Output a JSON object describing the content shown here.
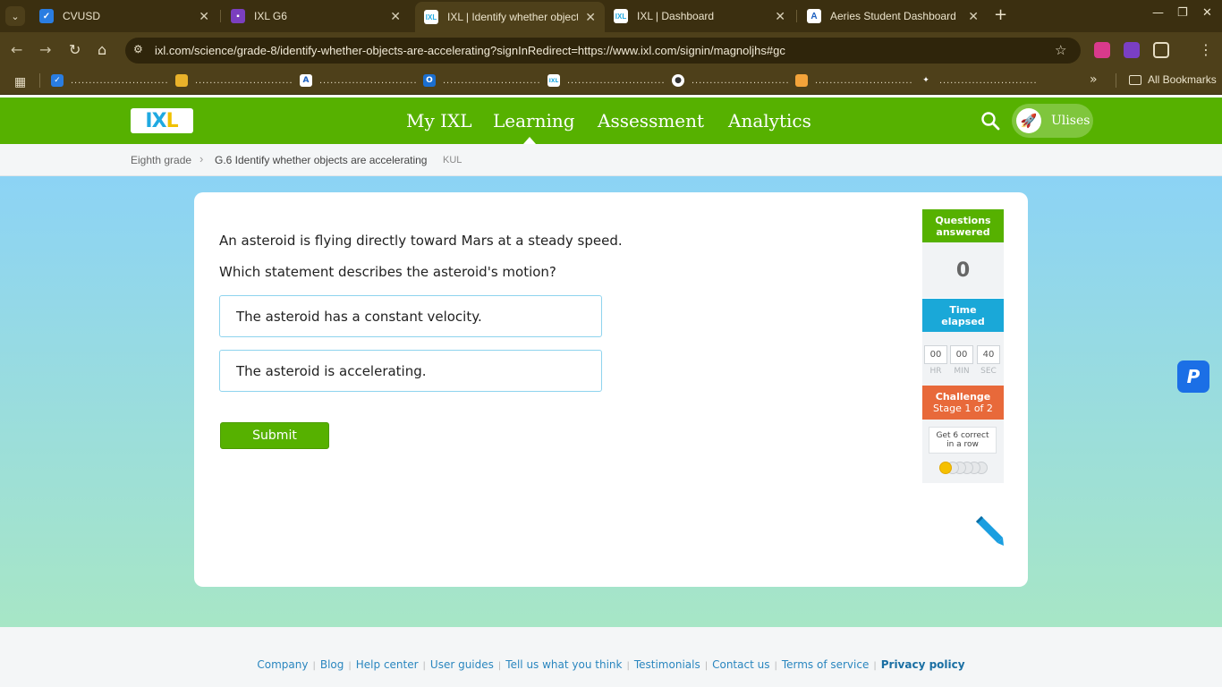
{
  "browser": {
    "tabs": [
      {
        "title": "CVUSD",
        "favicon_color": "#2a7de1"
      },
      {
        "title": "IXL G6",
        "favicon_color": "#7b3fbf"
      },
      {
        "title": "IXL | Identify whether objects are",
        "favicon_color": "#f0c100",
        "active": true
      },
      {
        "title": "IXL | Dashboard",
        "favicon_color": "#f0c100"
      },
      {
        "title": "Aeries Student Dashboard",
        "favicon_color": "#1b5fbf"
      }
    ],
    "url": "ixl.com/science/grade-8/identify-whether-objects-are-accelerating?signInRedirect=https://www.ixl.com/signin/magnoljhs#gc",
    "bookmarks_label": "All Bookmarks"
  },
  "nav": {
    "logo": {
      "part1": "IX",
      "part2": "L"
    },
    "links": [
      "My IXL",
      "Learning",
      "Assessment",
      "Analytics"
    ],
    "active": "Learning",
    "user": "Ulises"
  },
  "breadcrumb": {
    "grade": "Eighth grade",
    "skill": "G.6 Identify whether objects are accelerating",
    "code": "KUL"
  },
  "question": {
    "prompt": "An asteroid is flying directly toward Mars at a steady speed.",
    "ask": "Which statement describes the asteroid's motion?",
    "choices": [
      "The asteroid has a constant velocity.",
      "The asteroid is accelerating."
    ],
    "submit_label": "Submit"
  },
  "sidebar": {
    "questions_answered_label": "Questions answered",
    "questions_answered": "0",
    "time_elapsed_label": "Time elapsed",
    "time": {
      "hr": "00",
      "min": "00",
      "sec": "40"
    },
    "time_units": {
      "hr": "HR",
      "min": "MIN",
      "sec": "SEC"
    },
    "challenge_label": "Challenge",
    "challenge_stage": "Stage 1 of 2",
    "challenge_goal": "Get 6 correct in a row",
    "challenge_progress": {
      "completed": 1,
      "total": 6
    },
    "colors": {
      "answered": "#56b100",
      "time": "#1aa8d8",
      "challenge": "#e8693a",
      "progress_dot": "#f5c000"
    }
  },
  "footer": {
    "links": [
      "Company",
      "Blog",
      "Help center",
      "User guides",
      "Tell us what you think",
      "Testimonials",
      "Contact us",
      "Terms of service",
      "Privacy policy"
    ]
  }
}
